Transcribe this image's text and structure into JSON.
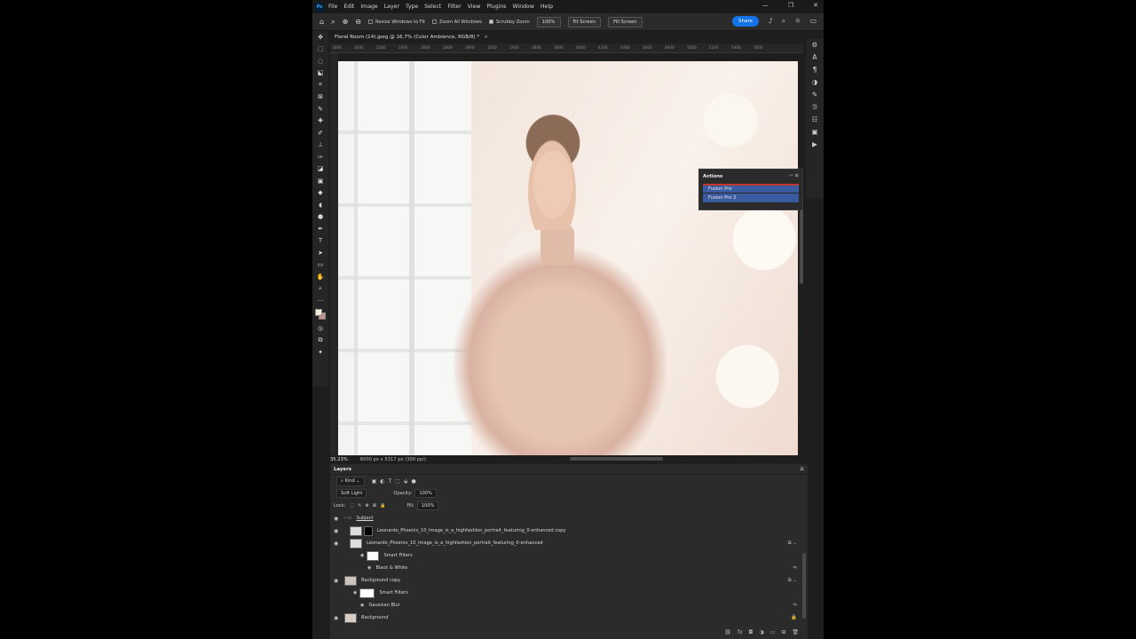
{
  "menubar": {
    "logo": "Ps",
    "items": [
      "File",
      "Edit",
      "Image",
      "Layer",
      "Type",
      "Select",
      "Filter",
      "View",
      "Plugins",
      "Window",
      "Help"
    ],
    "window_controls": [
      "—",
      "❐",
      "✕"
    ]
  },
  "options": {
    "resize_windows": "Resize Windows to Fit",
    "zoom_all": "Zoom All Windows",
    "scrubby_zoom": "Scrubby Zoom",
    "zoom_percent": "100%",
    "fit_screen": "Fit Screen",
    "fill_screen": "Fill Screen",
    "share": "Share"
  },
  "document": {
    "tab_title": "Floral Room (14).jpeg @ 16,7% (Color Ambience, RGB/8) *",
    "close": "×"
  },
  "ruler": {
    "ticks": [
      "1800",
      "2000",
      "2200",
      "2400",
      "2600",
      "2800",
      "3000",
      "3200",
      "3400",
      "3600",
      "3800",
      "4000",
      "4200",
      "4400",
      "4600",
      "4800",
      "5000",
      "5200",
      "5400",
      "5600"
    ]
  },
  "status": {
    "zoom": "35.23%",
    "doc_size": "8000 px x 5317 px (300 ppi)"
  },
  "actions": {
    "title": "Actions",
    "items": [
      "Fusion Pro",
      "Fusion Pro 2"
    ]
  },
  "layers": {
    "title": "Layers",
    "filter_kind": "Kind",
    "blend_mode": "Soft Light",
    "opacity_label": "Opacity:",
    "opacity_value": "100%",
    "lock_label": "Lock:",
    "fill_label": "Fill:",
    "fill_value": "100%",
    "rows": [
      "Subject",
      "Leonardo_Phoenix_10_Image_is_a_highfashion_portrait_featuring_0-enhanced  copy",
      "Leonardo_Phoenix_10_Image_is_a_highfashion_portrait_featuring_0-enhanced",
      "Smart Filters",
      "Black & White",
      "Background copy",
      "Smart Filters",
      "Gaussian Blur",
      "Background"
    ]
  },
  "colors": {
    "accent": "#1473e6",
    "action_selected": "#3a5ba0",
    "record_red": "#c0392b",
    "foreground": "#f0e9d6",
    "background": "#c8948c"
  }
}
